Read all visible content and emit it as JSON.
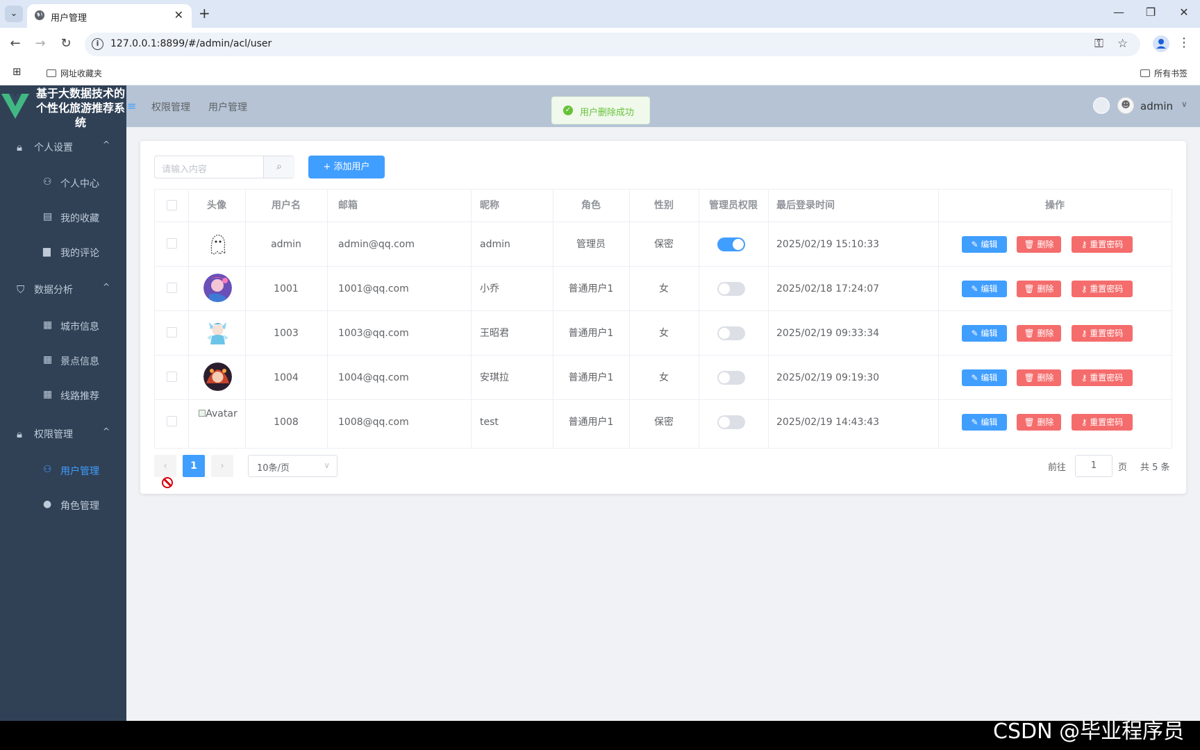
{
  "browser": {
    "tab_title": "用户管理",
    "url": "127.0.0.1:8899/#/admin/acl/user",
    "bookmarks_left": "网址收藏夹",
    "bookmarks_right": "所有书签"
  },
  "app": {
    "logo_text": "基于大数据技术的个性化旅游推荐系统",
    "brand_color": "#409eff"
  },
  "sidebar": {
    "groups": [
      {
        "label": "个人设置",
        "icon": "lock-icon",
        "items": [
          {
            "label": "个人中心",
            "icon": "user-icon"
          },
          {
            "label": "我的收藏",
            "icon": "bookmark-icon"
          },
          {
            "label": "我的评论",
            "icon": "comment-icon"
          }
        ]
      },
      {
        "label": "数据分析",
        "icon": "chart-icon",
        "items": [
          {
            "label": "城市信息",
            "icon": "document-icon"
          },
          {
            "label": "景点信息",
            "icon": "document-icon"
          },
          {
            "label": "线路推荐",
            "icon": "document-icon"
          }
        ]
      },
      {
        "label": "权限管理",
        "icon": "lock-icon",
        "items": [
          {
            "label": "用户管理",
            "icon": "user-icon",
            "active": true
          },
          {
            "label": "角色管理",
            "icon": "user-solid-icon"
          }
        ]
      }
    ]
  },
  "header": {
    "breadcrumb": [
      "权限管理",
      "用户管理"
    ],
    "toast": "用户删除成功",
    "username": "admin"
  },
  "toolbar": {
    "search_placeholder": "请输入内容",
    "add_label": "添加用户"
  },
  "table": {
    "columns": [
      "头像",
      "用户名",
      "邮箱",
      "昵称",
      "角色",
      "性别",
      "管理员权限",
      "最后登录时间",
      "操作"
    ],
    "actions": {
      "edit": "编辑",
      "delete": "删除",
      "reset": "重置密码"
    },
    "rows": [
      {
        "avatar": "ghost",
        "username": "admin",
        "email": "admin@qq.com",
        "nickname": "admin",
        "role": "管理员",
        "gender": "保密",
        "is_admin": true,
        "last_login": "2025/02/19 15:10:33"
      },
      {
        "avatar": "purple",
        "username": "1001",
        "email": "1001@qq.com",
        "nickname": "小乔",
        "role": "普通用户1",
        "gender": "女",
        "is_admin": false,
        "last_login": "2025/02/18 17:24:07"
      },
      {
        "avatar": "fairy",
        "username": "1003",
        "email": "1003@qq.com",
        "nickname": "王昭君",
        "role": "普通用户1",
        "gender": "女",
        "is_admin": false,
        "last_login": "2025/02/19 09:33:34"
      },
      {
        "avatar": "fire",
        "username": "1004",
        "email": "1004@qq.com",
        "nickname": "安琪拉",
        "role": "普通用户1",
        "gender": "女",
        "is_admin": false,
        "last_login": "2025/02/19 09:19:30"
      },
      {
        "avatar": "broken",
        "avatar_alt": "Avatar",
        "username": "1008",
        "email": "1008@qq.com",
        "nickname": "test",
        "role": "普通用户1",
        "gender": "保密",
        "is_admin": false,
        "last_login": "2025/02/19 14:43:43"
      }
    ]
  },
  "pagination": {
    "current_page": "1",
    "page_size": "10条/页",
    "goto_label": "前往",
    "goto_value": "1",
    "goto_suffix": "页",
    "total": "共 5 条"
  },
  "watermark": "CSDN @毕业程序员"
}
